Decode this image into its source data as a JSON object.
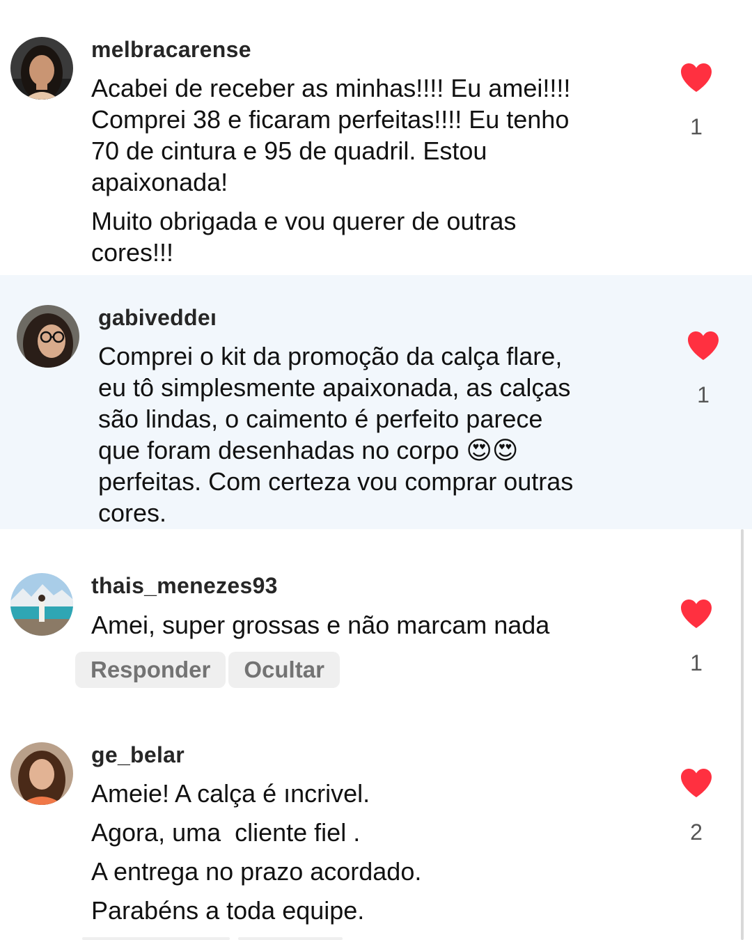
{
  "comments": [
    {
      "username": "melbracarense",
      "paragraphs": [
        "Acabei de receber as minhas!!!! Eu amei!!!!\nComprei 38 e ficaram perfeitas!!!! Eu tenho\n70 de cintura e 95 de quadril. Estou\napaixonada!",
        "Muito obrigada e vou querer de outras\ncores!!!"
      ],
      "likes": "1",
      "avatar_icon": "profile-photo"
    },
    {
      "username": "gabiveddeı",
      "paragraphs": [
        "Comprei o kit da promoção da calça flare,\neu tô simplesmente apaixonada, as calças\nsão lindas, o caimento é perfeito parece\nque foram desenhadas no corpo 😍😍\nperfeitas. Com certeza vou comprar outras\ncores."
      ],
      "likes": "1",
      "avatar_icon": "profile-photo"
    },
    {
      "username": "thais_menezes93",
      "paragraphs": [
        "Amei, super grossas e não marcam nada"
      ],
      "likes": "1",
      "avatar_icon": "profile-photo",
      "actions": {
        "reply": "Responder",
        "hide": "Ocultar"
      }
    },
    {
      "username": "ge_belar",
      "paragraphs": [
        "Ameie! A calça é ıncrivel.",
        "Agora, uma  cliente fiel .",
        "A entrega no prazo acordado.",
        "Parabéns a toda equipe."
      ],
      "likes": "2",
      "avatar_icon": "profile-photo"
    }
  ],
  "colors": {
    "heart": "#ff3040",
    "highlight_background": "#f2f7fc",
    "username": "#262626",
    "action_pill": "#efefef"
  },
  "icons": {
    "like": "heart-icon"
  }
}
